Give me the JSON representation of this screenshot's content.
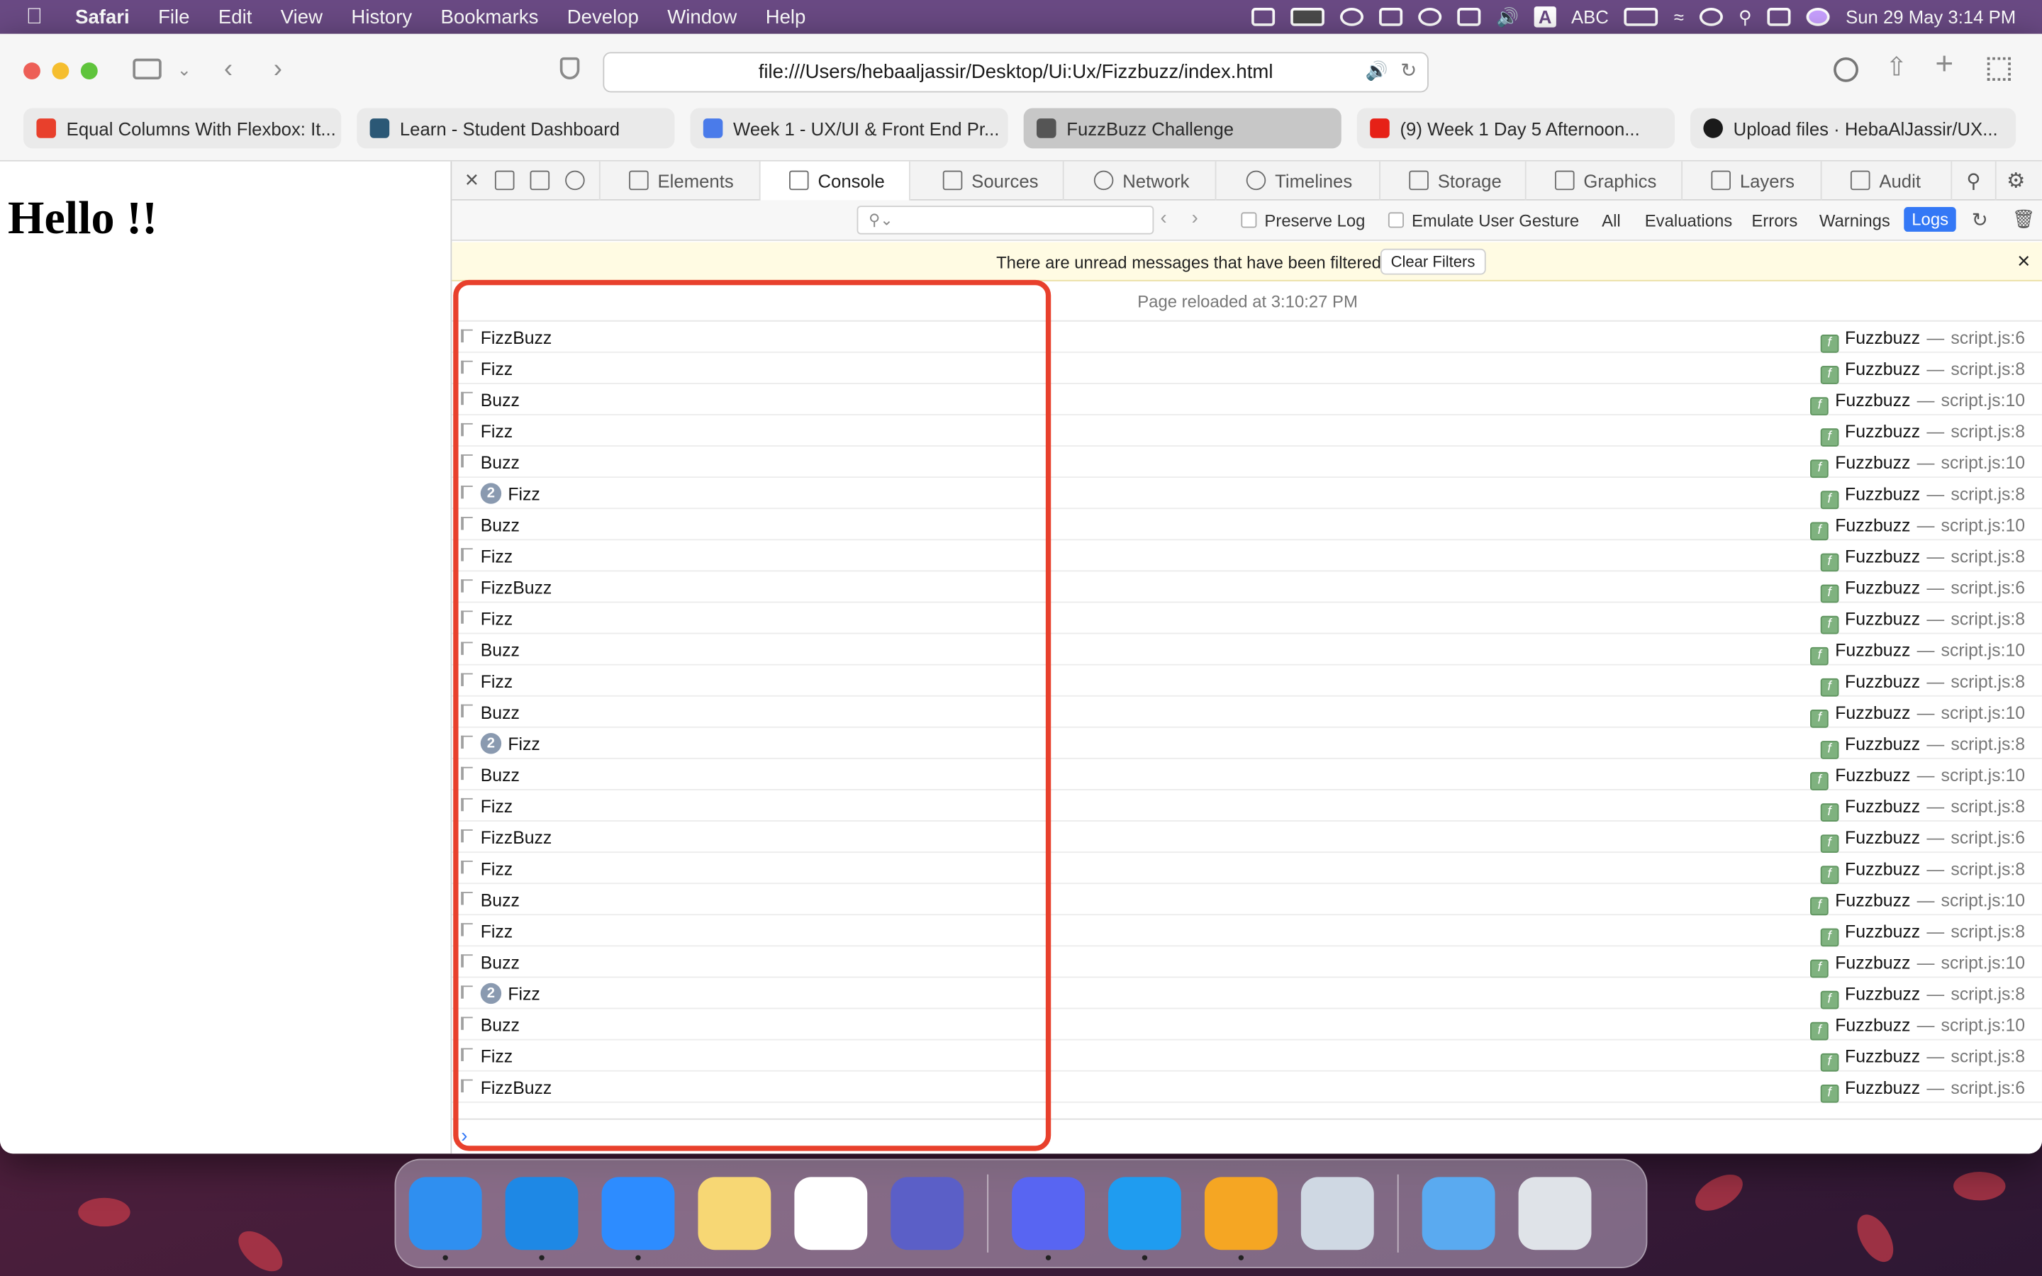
{
  "menubar": {
    "app": "Safari",
    "items": [
      "File",
      "Edit",
      "View",
      "History",
      "Bookmarks",
      "Develop",
      "Window",
      "Help"
    ],
    "input_source": "ABC",
    "clock": "Sun 29 May  3:14 PM"
  },
  "browser": {
    "address": "file:///Users/hebaaljassir/Desktop/Ui:Ux/Fizzbuzz/index.html",
    "tabs": [
      {
        "label": "Equal Columns With Flexbox: It...",
        "color": "#e8402c"
      },
      {
        "label": "Learn - Student Dashboard",
        "color": "#2b5876"
      },
      {
        "label": "Week 1 - UX/UI & Front End Pr...",
        "color": "#4a7bea"
      },
      {
        "label": "FuzzBuzz Challenge",
        "color": "#555555"
      },
      {
        "label": "(9) Week 1 Day 5 Afternoon...",
        "color": "#e62117"
      },
      {
        "label": "Upload files · HebaAlJassir/UX...",
        "color": "#1a1a1a"
      }
    ]
  },
  "page": {
    "heading": "Hello !!"
  },
  "devtools": {
    "tabs": [
      "Elements",
      "Console",
      "Sources",
      "Network",
      "Timelines",
      "Storage",
      "Graphics",
      "Layers",
      "Audit"
    ],
    "filter": {
      "preserve_log": "Preserve Log",
      "emulate_gesture": "Emulate User Gesture",
      "all": "All",
      "evaluations": "Evaluations",
      "errors": "Errors",
      "warnings": "Warnings",
      "logs": "Logs"
    },
    "banner": {
      "text": "There are unread messages that have been filtered",
      "button": "Clear Filters"
    },
    "reload": "Page reloaded at 3:10:27 PM",
    "function_name": "Fuzzbuzz",
    "separator": "—",
    "rows": [
      {
        "msg": "FizzBuzz",
        "count": "",
        "src": "script.js:6"
      },
      {
        "msg": "Fizz",
        "count": "",
        "src": "script.js:8"
      },
      {
        "msg": "Buzz",
        "count": "",
        "src": "script.js:10"
      },
      {
        "msg": "Fizz",
        "count": "",
        "src": "script.js:8"
      },
      {
        "msg": "Buzz",
        "count": "",
        "src": "script.js:10"
      },
      {
        "msg": "Fizz",
        "count": "2",
        "src": "script.js:8"
      },
      {
        "msg": "Buzz",
        "count": "",
        "src": "script.js:10"
      },
      {
        "msg": "Fizz",
        "count": "",
        "src": "script.js:8"
      },
      {
        "msg": "FizzBuzz",
        "count": "",
        "src": "script.js:6"
      },
      {
        "msg": "Fizz",
        "count": "",
        "src": "script.js:8"
      },
      {
        "msg": "Buzz",
        "count": "",
        "src": "script.js:10"
      },
      {
        "msg": "Fizz",
        "count": "",
        "src": "script.js:8"
      },
      {
        "msg": "Buzz",
        "count": "",
        "src": "script.js:10"
      },
      {
        "msg": "Fizz",
        "count": "2",
        "src": "script.js:8"
      },
      {
        "msg": "Buzz",
        "count": "",
        "src": "script.js:10"
      },
      {
        "msg": "Fizz",
        "count": "",
        "src": "script.js:8"
      },
      {
        "msg": "FizzBuzz",
        "count": "",
        "src": "script.js:6"
      },
      {
        "msg": "Fizz",
        "count": "",
        "src": "script.js:8"
      },
      {
        "msg": "Buzz",
        "count": "",
        "src": "script.js:10"
      },
      {
        "msg": "Fizz",
        "count": "",
        "src": "script.js:8"
      },
      {
        "msg": "Buzz",
        "count": "",
        "src": "script.js:10"
      },
      {
        "msg": "Fizz",
        "count": "2",
        "src": "script.js:8"
      },
      {
        "msg": "Buzz",
        "count": "",
        "src": "script.js:10"
      },
      {
        "msg": "Fizz",
        "count": "",
        "src": "script.js:8"
      },
      {
        "msg": "FizzBuzz",
        "count": "",
        "src": "script.js:6"
      }
    ]
  },
  "dock": [
    {
      "name": "finder",
      "color": "#2f8ff0"
    },
    {
      "name": "safari",
      "color": "#1e88e5"
    },
    {
      "name": "zoom",
      "color": "#2d8cff"
    },
    {
      "name": "notes",
      "color": "#f7d774"
    },
    {
      "name": "slack",
      "color": "#ffffff"
    },
    {
      "name": "teams",
      "color": "#5b5fc7"
    },
    {
      "name": "discord",
      "color": "#5865f2"
    },
    {
      "name": "vscode",
      "color": "#1f9cf0"
    },
    {
      "name": "photos",
      "color": "#f5a623"
    },
    {
      "name": "preview",
      "color": "#cfd8e3"
    },
    {
      "name": "downloads-folder",
      "color": "#5aaaf0"
    },
    {
      "name": "trash",
      "color": "#dfe3e8"
    }
  ],
  "colors": {
    "highlight": "#e8402c",
    "accent": "#3478f6"
  }
}
